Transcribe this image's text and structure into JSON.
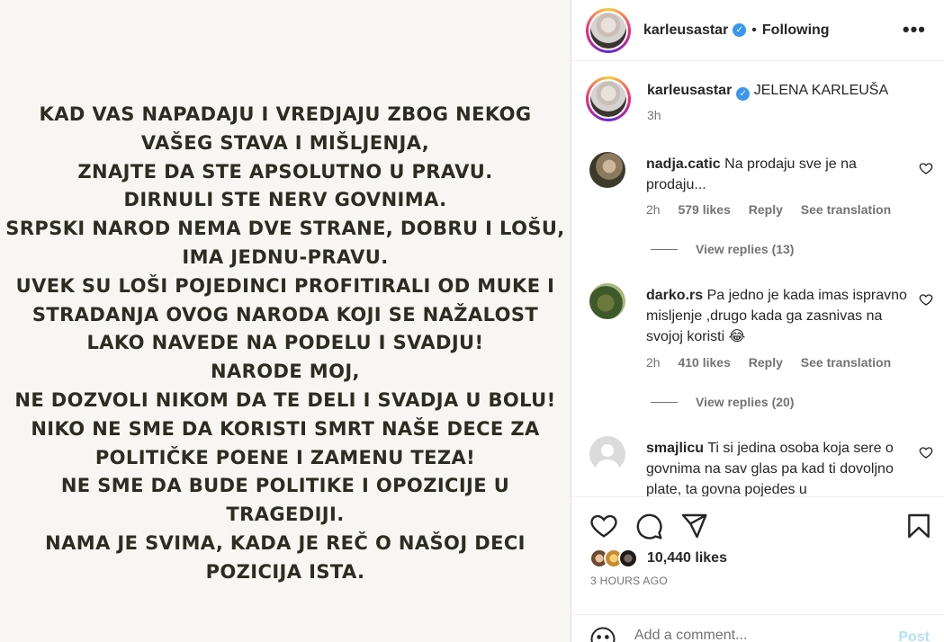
{
  "media": {
    "lines": [
      "KAD VAS NAPADAJU I VREDJAJU ZBOG NEKOG",
      "VAŠEG STAVA I MIŠLJENJA,",
      "ZNAJTE DA STE APSOLUTNO U PRAVU.",
      "DIRNULI STE NERV GOVNIMA.",
      "SRPSKI NAROD NEMA DVE STRANE, DOBRU I LOŠU,",
      "IMA JEDNU-PRAVU.",
      "UVEK SU LOŠI POJEDINCI PROFITIRALI OD MUKE I",
      "STRADANJA OVOG NARODA KOJI SE NAŽALOST",
      "LAKO NAVEDE NA PODELU I SVADJU!",
      "NARODE MOJ,",
      "NE DOZVOLI NIKOM DA TE DELI I SVADJA U BOLU!",
      "NIKO NE SME DA KORISTI SMRT NAŠE DECE ZA",
      "POLITIČKE POENE I ZAMENU TEZA!",
      "NE SME DA BUDE POLITIKE I OPOZICIJE U",
      "TRAGEDIJI.",
      "NAMA JE SVIMA,  KADA JE REČ O NAŠOJ DECI",
      "POZICIJA ISTA."
    ]
  },
  "header": {
    "username": "karleusastar",
    "verified_icon": "verified-badge-icon",
    "separator": "•",
    "follow_status": "Following",
    "more_label": "•••"
  },
  "caption": {
    "username": "karleusastar",
    "text": "JELENA KARLEUŠA",
    "time": "3h"
  },
  "comments": [
    {
      "username": "nadja.catic",
      "text": "Na prodaju sve je na prodaju...",
      "time": "2h",
      "likes": "579 likes",
      "reply": "Reply",
      "translate": "See translation",
      "view_replies": "View replies (13)"
    },
    {
      "username": "darko.rs",
      "text": "Pa jedno je kada imas ispravno misljenje ,drugo kada ga zasnivas na svojoj koristi 😂",
      "time": "2h",
      "likes": "410 likes",
      "reply": "Reply",
      "translate": "See translation",
      "view_replies": "View replies (20)"
    },
    {
      "username": "smajlicu",
      "text": "Ti si jedina osoba koja sere o govnima na sav glas pa kad ti dovoljno plate, ta govna pojedes u"
    }
  ],
  "actions": {
    "likes": "10,440 likes",
    "posted": "3 HOURS AGO",
    "comment_placeholder": "Add a comment...",
    "post_label": "Post"
  },
  "colors": {
    "verified": "#3897f0",
    "secondary_text": "#737373",
    "post_button": "#b2dffc"
  }
}
